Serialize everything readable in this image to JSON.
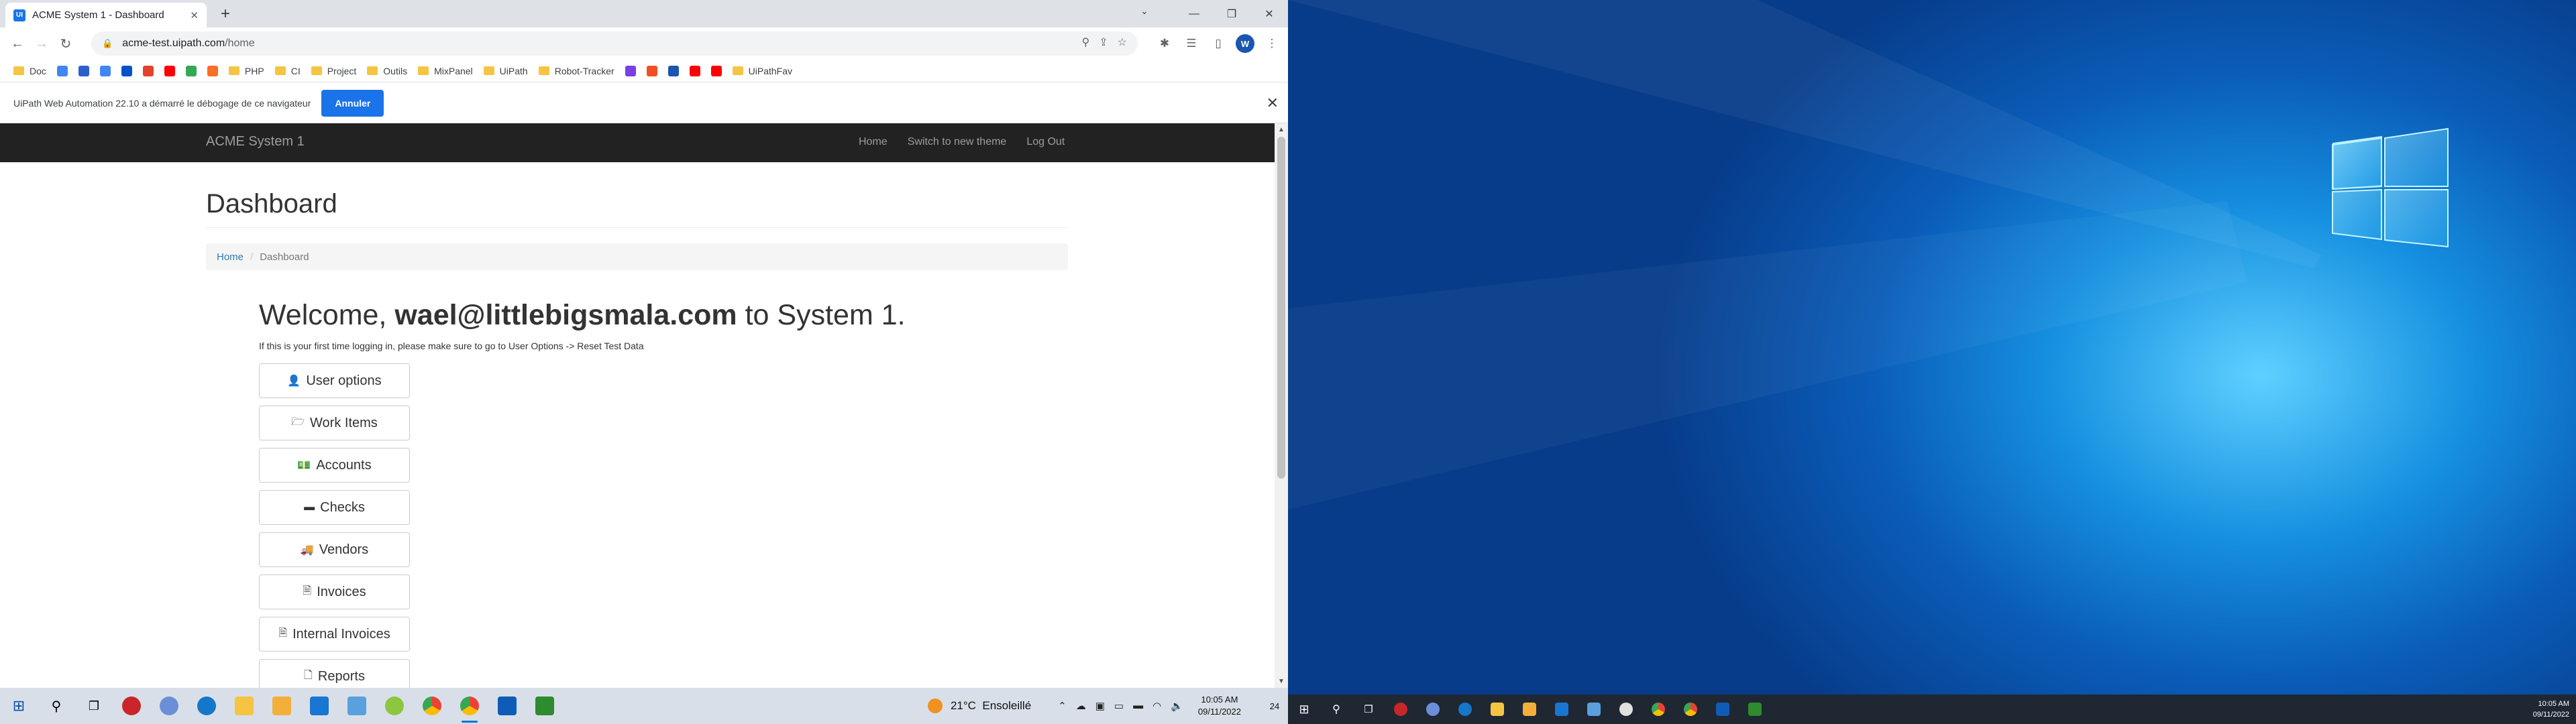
{
  "browser": {
    "tab_title": "ACME System 1 - Dashboard",
    "favicon_text": "UI",
    "new_tab": "+",
    "url_host": "acme-test.uipath.com",
    "url_path": "/home",
    "profile_initial": "W",
    "window_controls": {
      "chevron": "⌄",
      "minimize": "—",
      "maximize": "❐",
      "close": "✕"
    }
  },
  "bookmarks": [
    {
      "label": "Doc",
      "kind": "folder"
    },
    {
      "label": "",
      "kind": "icon",
      "color": "#4285f4"
    },
    {
      "label": "",
      "kind": "icon",
      "color": "#2c5fcd"
    },
    {
      "label": "",
      "kind": "icon",
      "color": "#4285f4"
    },
    {
      "label": "",
      "kind": "icon",
      "color": "#0052cc"
    },
    {
      "label": "",
      "kind": "icon",
      "color": "#e2432a"
    },
    {
      "label": "",
      "kind": "icon",
      "color": "#ff0000"
    },
    {
      "label": "",
      "kind": "icon",
      "color": "#34a853"
    },
    {
      "label": "",
      "kind": "icon",
      "color": "#fc6d26"
    },
    {
      "label": "PHP",
      "kind": "folder"
    },
    {
      "label": "CI",
      "kind": "folder"
    },
    {
      "label": "Project",
      "kind": "folder"
    },
    {
      "label": "Outils",
      "kind": "folder"
    },
    {
      "label": "MixPanel",
      "kind": "folder"
    },
    {
      "label": "UiPath",
      "kind": "folder"
    },
    {
      "label": "Robot-Tracker",
      "kind": "folder"
    },
    {
      "label": "",
      "kind": "icon",
      "color": "#7b3fe4"
    },
    {
      "label": "",
      "kind": "icon",
      "color": "#f25022"
    },
    {
      "label": "",
      "kind": "icon",
      "color": "#1a56b0"
    },
    {
      "label": "",
      "kind": "icon",
      "color": "#ff0000"
    },
    {
      "label": "",
      "kind": "icon",
      "color": "#ff0000"
    },
    {
      "label": "UiPathFav",
      "kind": "folder"
    }
  ],
  "infobar": {
    "message": "UiPath Web Automation 22.10 a démarré le débogage de ce navigateur",
    "cancel_label": "Annuler"
  },
  "site": {
    "brand": "ACME System 1",
    "nav": [
      "Home",
      "Switch to new theme",
      "Log Out"
    ],
    "heading": "Dashboard",
    "breadcrumb_home": "Home",
    "breadcrumb_current": "Dashboard",
    "welcome_prefix": "Welcome, ",
    "welcome_user": "wael@littlebigsmala.com",
    "welcome_suffix": " to System 1.",
    "note": "If this is your first time logging in, please make sure to go to User Options -> Reset Test Data",
    "buttons": [
      {
        "label": "User options",
        "icon": "👤"
      },
      {
        "label": "Work Items",
        "icon": "🗁"
      },
      {
        "label": "Accounts",
        "icon": "💵"
      },
      {
        "label": "Checks",
        "icon": "▬"
      },
      {
        "label": "Vendors",
        "icon": "🚚"
      },
      {
        "label": "Invoices",
        "icon": "🗎"
      },
      {
        "label": "Internal Invoices",
        "icon": "🗎"
      },
      {
        "label": "Reports",
        "icon": "🗋"
      }
    ]
  },
  "taskbar_left": {
    "weather_temp": "21°C",
    "weather_desc": "Ensoleillé",
    "time": "10:05 AM",
    "date": "09/11/2022",
    "notification_count": "24"
  },
  "taskbar_right": {
    "time": "10:05 AM",
    "date": "09/11/2022"
  },
  "colors": {
    "accent_blue": "#1a73e8",
    "navbar_bg": "#222222",
    "link_blue": "#337ab7"
  }
}
